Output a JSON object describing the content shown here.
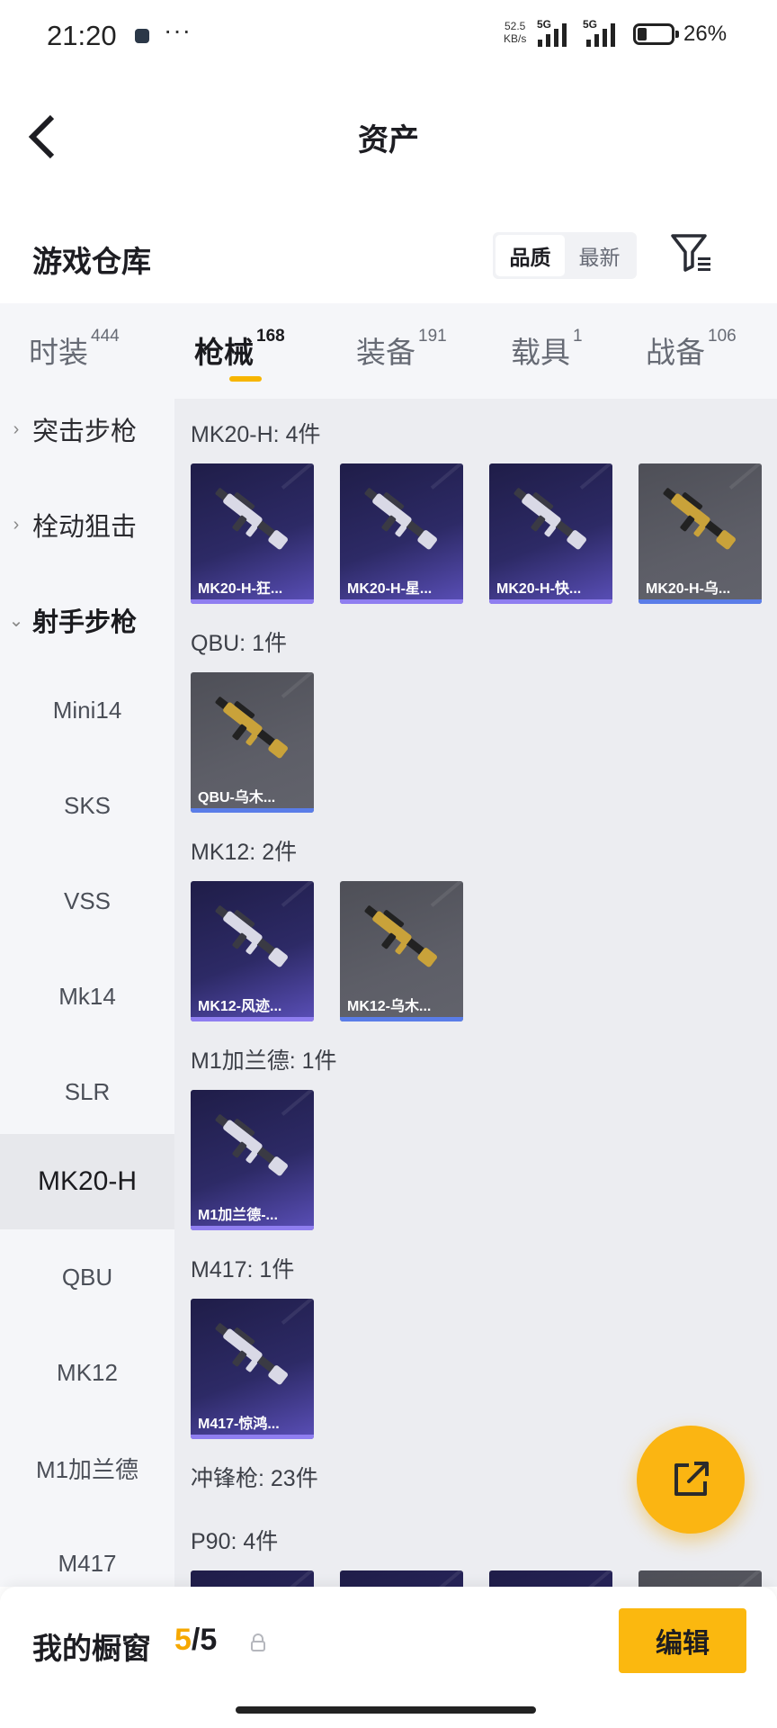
{
  "status_bar": {
    "time": "21:20",
    "dots": "···",
    "net_speed_value": "52.5",
    "net_speed_unit": "KB/s",
    "sim1": "5G",
    "sim2": "5G",
    "battery_pct": "26%",
    "battery_level": 0.26
  },
  "nav": {
    "title": "资产",
    "back_icon": "chevron-left-icon"
  },
  "warehouse": {
    "title": "游戏仓库",
    "sort_options": [
      "品质",
      "最新"
    ],
    "sort_selected": "品质",
    "filter_icon": "filter-icon"
  },
  "tabs": [
    {
      "label": "时装",
      "count": "444"
    },
    {
      "label": "枪械",
      "count": "168",
      "active": true
    },
    {
      "label": "装备",
      "count": "191"
    },
    {
      "label": "载具",
      "count": "1"
    },
    {
      "label": "战备",
      "count": "106"
    }
  ],
  "sidebar": {
    "categories": [
      {
        "label": "突击步枪",
        "expanded": false
      },
      {
        "label": "栓动狙击",
        "expanded": false
      },
      {
        "label": "射手步枪",
        "expanded": true
      }
    ],
    "subitems": [
      "Mini14",
      "SKS",
      "VSS",
      "Mk14",
      "SLR",
      "MK20-H",
      "QBU",
      "MK12",
      "M1加兰德",
      "M417"
    ],
    "active_subitem": "MK20-H"
  },
  "groups": [
    {
      "title": "MK20-H: 4件",
      "items": [
        {
          "name": "MK20-H-狂...",
          "tier": "purple"
        },
        {
          "name": "MK20-H-星...",
          "tier": "purple"
        },
        {
          "name": "MK20-H-快...",
          "tier": "purple"
        },
        {
          "name": "MK20-H-乌...",
          "tier": "grey"
        }
      ]
    },
    {
      "title": "QBU: 1件",
      "items": [
        {
          "name": "QBU-乌木...",
          "tier": "grey"
        }
      ]
    },
    {
      "title": "MK12: 2件",
      "items": [
        {
          "name": "MK12-风迹...",
          "tier": "purple"
        },
        {
          "name": "MK12-乌木...",
          "tier": "grey"
        }
      ]
    },
    {
      "title": "M1加兰德: 1件",
      "items": [
        {
          "name": "M1加兰德-...",
          "tier": "purple"
        }
      ]
    },
    {
      "title": "M417: 1件",
      "items": [
        {
          "name": "M417-惊鸿...",
          "tier": "purple"
        }
      ]
    },
    {
      "title": "冲锋枪: 23件",
      "items": []
    },
    {
      "title": "P90: 4件",
      "items": [
        {
          "name": "",
          "tier": "purple"
        },
        {
          "name": "",
          "tier": "purple"
        },
        {
          "name": "",
          "tier": "purple"
        },
        {
          "name": "",
          "tier": "grey"
        }
      ]
    }
  ],
  "fab": {
    "icon": "share-external-icon"
  },
  "showcase": {
    "title": "我的橱窗",
    "used": "5",
    "separator": "/",
    "total": "5",
    "lock_icon": "lock-icon",
    "edit_label": "编辑"
  }
}
